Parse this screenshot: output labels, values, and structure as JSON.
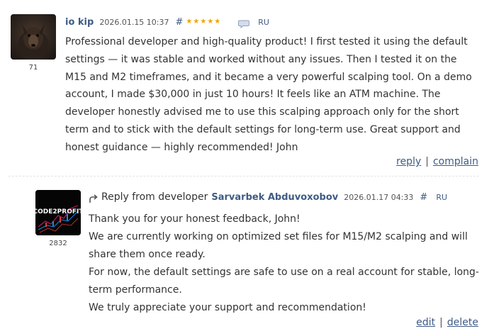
{
  "comment": {
    "author": "io kip",
    "timestamp": "2026.01.15 10:37",
    "hash": "#",
    "star_rating": 5,
    "star_color": "#f0a500",
    "translate_icon": "speech-bubble-icon",
    "language": "RU",
    "user_rating": "71",
    "body": "Professional developer and high-quality product! I first tested it using the default settings — it was stable and worked without any issues. Then I tested it on the M15 and M2 timeframes, and it became a very powerful scalping tool. On a demo account, I made $30,000 in just 10 hours! It feels like an ATM machine. The developer honestly advised me to use this scalping approach only for the short term and to stick with the default settings for long-term use. Great support and honest guidance — highly recommended! John",
    "actions": {
      "reply": "reply",
      "separator": "|",
      "complain": "complain"
    }
  },
  "reply": {
    "label": "Reply from developer",
    "arrow_icon": "reply-arrow-icon",
    "developer_name": "Sarvarbek Abduvoxobov",
    "timestamp": "2026.01.17 04:33",
    "hash": "#",
    "language": "RU",
    "user_rating": "2832",
    "avatar_logo_text": "CODE2PROFIT",
    "lines": [
      "Thank you for your honest feedback, John!",
      "We are currently working on optimized set files for M15/M2 scalping and will share them once ready.",
      "For now, the default settings are safe to use on a real account for stable, long-term performance.",
      "We truly appreciate your support and recommendation!"
    ],
    "actions": {
      "edit": "edit",
      "separator": "|",
      "delete": "delete"
    }
  },
  "colors": {
    "link": "#3f5b85",
    "text": "#333333",
    "divider": "#e3e3e3"
  }
}
